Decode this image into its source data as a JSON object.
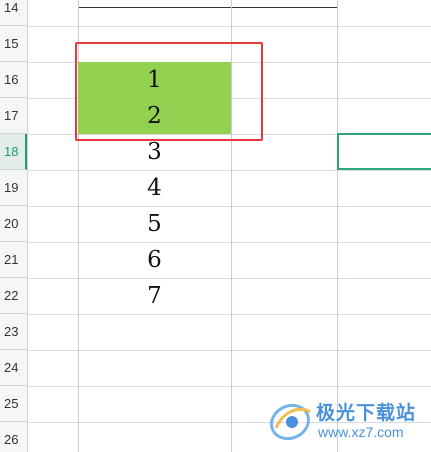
{
  "row_headers": [
    "14",
    "15",
    "16",
    "17",
    "18",
    "19",
    "20",
    "21",
    "22",
    "23",
    "24",
    "25",
    "26"
  ],
  "active_row": "18",
  "cells": {
    "r16": "1",
    "r17": "2",
    "r18": "3",
    "r19": "4",
    "r20": "5",
    "r21": "6",
    "r22": "7"
  },
  "colors": {
    "selection_fill": "#92d050",
    "annotation_box": "#e63a3a",
    "active_cell_border": "#2fa67a",
    "active_row_text": "#1f9c70"
  },
  "watermark": {
    "title": "极光下载站",
    "url": "www.xz7.com",
    "icon": "aurora-logo-icon"
  }
}
